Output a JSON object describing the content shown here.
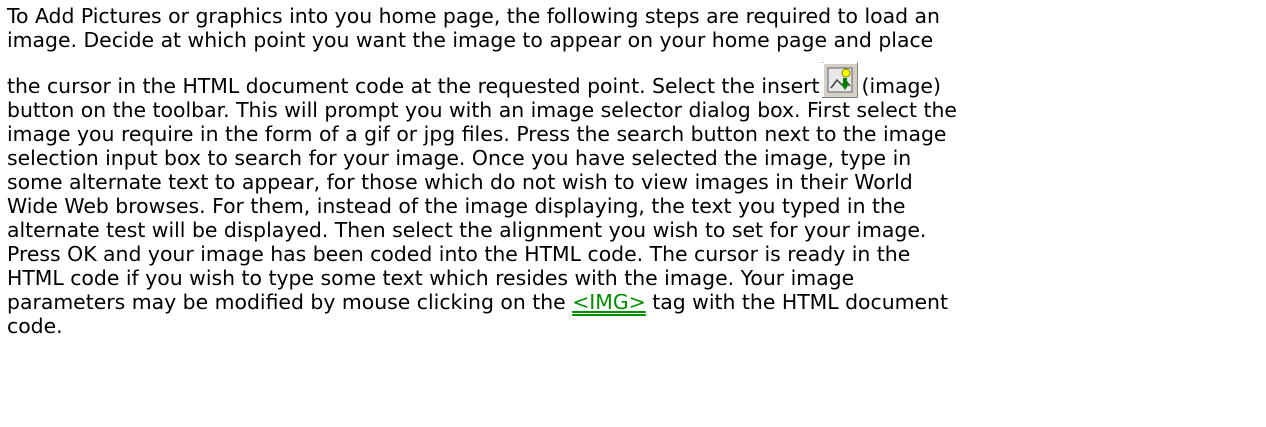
{
  "help_topic": {
    "lines": [
      "To Add Pictures or graphics into you home page, the following steps are required to load an",
      "image. Decide at which point you want the image to appear on your home page and place",
      "the cursor in the HTML document code at the requested point. Select the insert",
      "(image)",
      "button on the toolbar. This will prompt you with an image selector dialog box. First select the",
      "image you require in the form of a gif or jpg files. Press the search button next to the image",
      "selection input box to search for your image. Once you have selected the image, type in",
      "some alternate text to appear, for those which do not wish to view images in their World",
      "Wide Web browses. For them, instead of the image displaying, the text you typed in the",
      "alternate test will be displayed. Then select the alignment you wish to set for your image.",
      "Press OK and your image has been coded into the HTML code. The cursor is ready in the",
      "HTML code if you wish to type some text which resides with the image. Your image",
      "parameters may be modified by mouse clicking on the",
      "tag with the HTML document",
      "code."
    ],
    "link_label": "<IMG>",
    "inline_icon": "insert-image-toolbar-icon",
    "link_color": "#009000",
    "text_color": "#000000"
  }
}
